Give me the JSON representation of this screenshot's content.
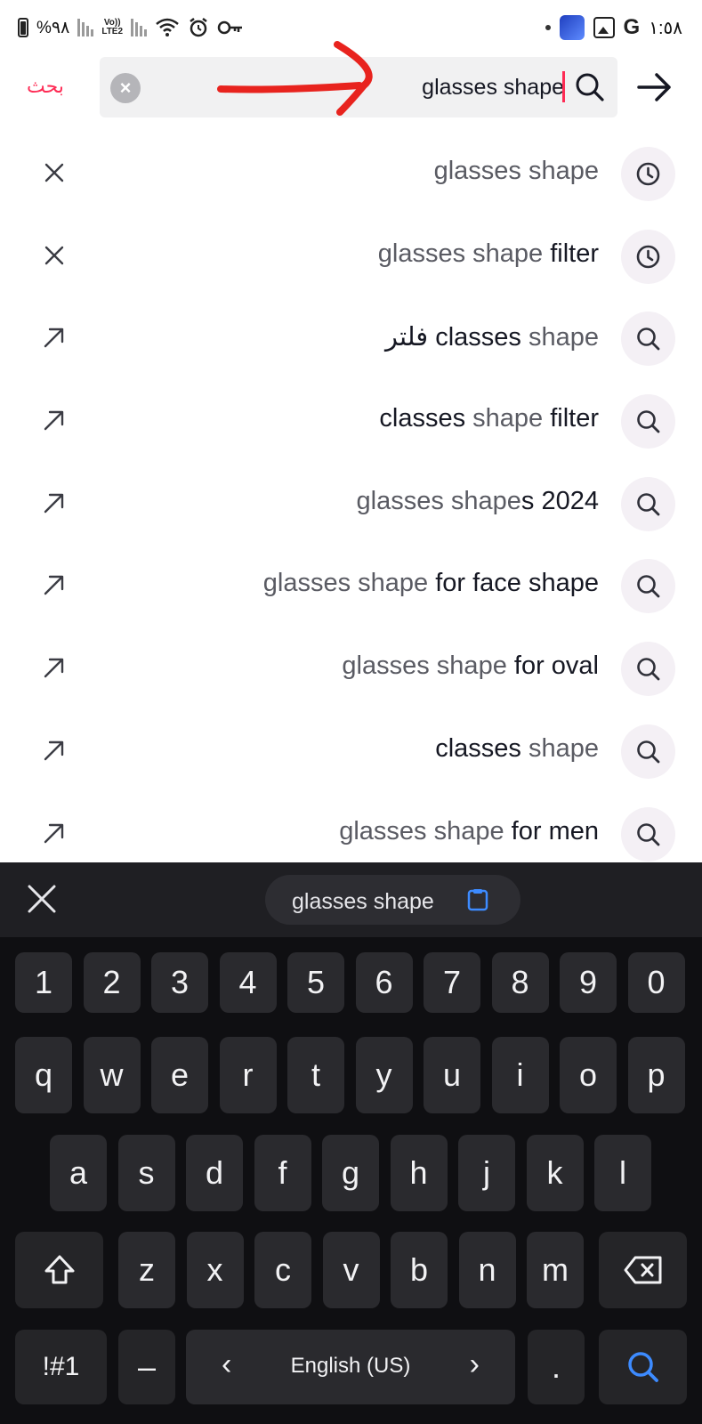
{
  "status_bar": {
    "battery_text": "%٩٨",
    "network_label_top": "Vo))",
    "network_label_bottom": "LTE2",
    "time": "١:٥٨"
  },
  "search": {
    "submit_label": "بحث",
    "query": "glasses shape",
    "clear_icon": "close-icon",
    "search_icon": "search-icon",
    "back_icon": "arrow-right-icon"
  },
  "suggestions": [
    {
      "type": "history",
      "left_icon": "close-icon",
      "right_icon": "clock-icon",
      "match": "glasses shape",
      "rest": ""
    },
    {
      "type": "history",
      "left_icon": "close-icon",
      "right_icon": "clock-icon",
      "match": "glasses shape",
      "rest": " filter"
    },
    {
      "type": "suggest",
      "left_icon": "arrow-up-left-icon",
      "right_icon": "search-icon",
      "match": "shape",
      "rest": "فلتر classes "
    },
    {
      "type": "suggest",
      "left_icon": "arrow-up-left-icon",
      "right_icon": "search-icon",
      "pre": "classes ",
      "match": "shape",
      "rest": " filter"
    },
    {
      "type": "suggest",
      "left_icon": "arrow-up-left-icon",
      "right_icon": "search-icon",
      "match": "glasses shape",
      "rest": "s 2024"
    },
    {
      "type": "suggest",
      "left_icon": "arrow-up-left-icon",
      "right_icon": "search-icon",
      "match": "glasses shape",
      "rest": " for face shape"
    },
    {
      "type": "suggest",
      "left_icon": "arrow-up-left-icon",
      "right_icon": "search-icon",
      "match": "glasses shape",
      "rest": " for oval"
    },
    {
      "type": "suggest",
      "left_icon": "arrow-up-left-icon",
      "right_icon": "search-icon",
      "pre": "classes ",
      "match": "shape",
      "rest": ""
    },
    {
      "type": "suggest",
      "left_icon": "arrow-up-left-icon",
      "right_icon": "search-icon",
      "match": "glasses shape",
      "rest": " for men"
    }
  ],
  "keyboard": {
    "clipboard_chip": "glasses shape",
    "row_numbers": [
      "1",
      "2",
      "3",
      "4",
      "5",
      "6",
      "7",
      "8",
      "9",
      "0"
    ],
    "row_top": [
      "q",
      "w",
      "e",
      "r",
      "t",
      "y",
      "u",
      "i",
      "o",
      "p"
    ],
    "row_middle": [
      "a",
      "s",
      "d",
      "f",
      "g",
      "h",
      "j",
      "k",
      "l"
    ],
    "row_bottom": [
      "z",
      "x",
      "c",
      "v",
      "b",
      "n",
      "m"
    ],
    "symbols_key": "!#1",
    "dash_key": "–",
    "space_label": "English (US)",
    "space_left_arrow": "‹",
    "space_right_arrow": "›",
    "period_key": ".",
    "colors": {
      "accent": "#fe2c55",
      "search_key": "#3d8bff"
    }
  }
}
